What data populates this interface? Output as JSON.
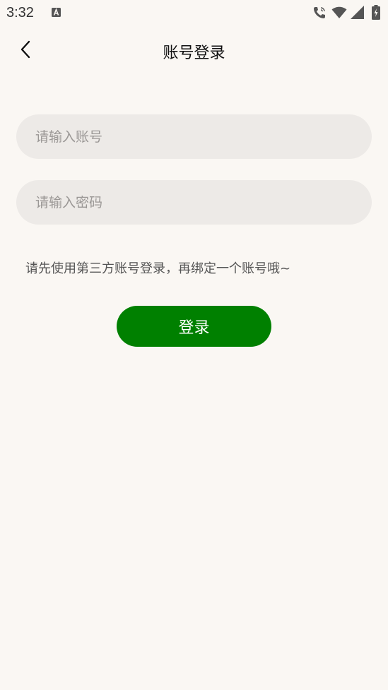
{
  "status_bar": {
    "time": "3:32",
    "icons": [
      "a-notification-icon",
      "wifi-call-icon",
      "wifi-icon",
      "signal-icon",
      "battery-charging-icon"
    ]
  },
  "header": {
    "title": "账号登录",
    "back_icon": "chevron-left-icon"
  },
  "form": {
    "account_placeholder": "请输入账号",
    "account_value": "",
    "password_placeholder": "请输入密码",
    "password_value": "",
    "hint": "请先使用第三方账号登录，再绑定一个账号哦~",
    "login_label": "登录"
  },
  "colors": {
    "background": "#faf7f3",
    "input_background": "#edeae7",
    "login_button": "#008000",
    "login_text": "#ffffff"
  }
}
